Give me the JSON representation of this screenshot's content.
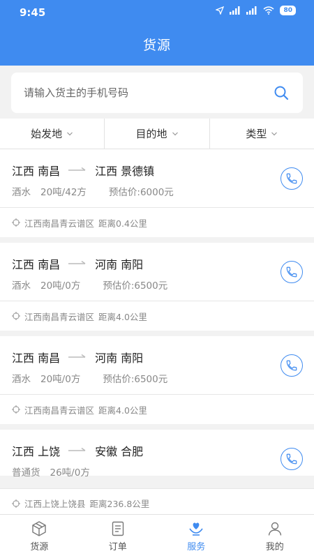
{
  "status": {
    "time": "9:45",
    "battery": "80"
  },
  "header": {
    "title": "货源"
  },
  "search": {
    "placeholder": "请输入货主的手机号码"
  },
  "filters": [
    {
      "label": "始发地"
    },
    {
      "label": "目的地"
    },
    {
      "label": "类型"
    }
  ],
  "cargo": [
    {
      "from": "江西 南昌",
      "to": "江西 景德镇",
      "goods": "酒水",
      "weight": "20吨/42方",
      "price": "预估价:6000元",
      "location": "江西南昌青云谱区",
      "distance": "距离0.4公里"
    },
    {
      "from": "江西 南昌",
      "to": "河南 南阳",
      "goods": "酒水",
      "weight": "20吨/0方",
      "price": "预估价:6500元",
      "location": "江西南昌青云谱区",
      "distance": "距离4.0公里"
    },
    {
      "from": "江西 南昌",
      "to": "河南 南阳",
      "goods": "酒水",
      "weight": "20吨/0方",
      "price": "预估价:6500元",
      "location": "江西南昌青云谱区",
      "distance": "距离4.0公里"
    },
    {
      "from": "江西 上饶",
      "to": "安徽 合肥",
      "goods": "普通货",
      "weight": "26吨/0方",
      "price": "",
      "location": "江西上饶上饶县",
      "distance": "距离236.8公里"
    }
  ],
  "tabs": [
    {
      "label": "货源",
      "icon": "box-icon"
    },
    {
      "label": "订单",
      "icon": "document-icon"
    },
    {
      "label": "服务",
      "icon": "heart-hand-icon",
      "active": true
    },
    {
      "label": "我的",
      "icon": "user-icon"
    }
  ],
  "colors": {
    "primary": "#3f8bf0",
    "text": "#222222",
    "muted": "#888888"
  }
}
